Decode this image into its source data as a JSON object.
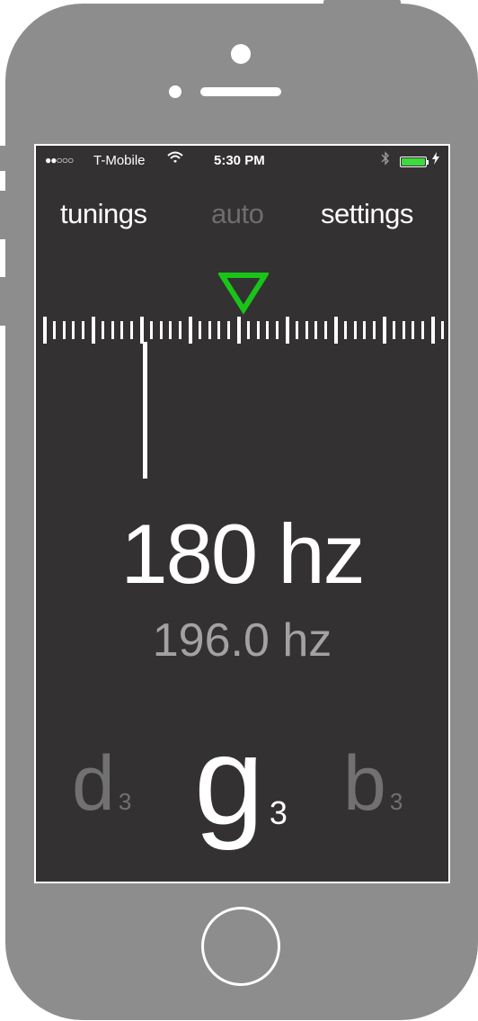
{
  "status_bar": {
    "signal": "●●○○○",
    "carrier": "T-Mobile",
    "time": "5:30 PM",
    "battery_level": 1.0,
    "battery_color": "#3ed93e"
  },
  "nav": {
    "tunings": "tunings",
    "auto": "auto",
    "settings": "settings"
  },
  "meter": {
    "target_marker_color": "#19c419",
    "current_frequency": "180 hz",
    "target_frequency": "196.0 hz"
  },
  "notes": {
    "previous": {
      "letter": "d",
      "octave": "3"
    },
    "current": {
      "letter": "g",
      "octave": "3"
    },
    "next": {
      "letter": "b",
      "octave": "3"
    }
  },
  "colors": {
    "screen_background": "#333132",
    "device_body": "#8e8d8e",
    "inactive_text": "#6e6d6e"
  }
}
